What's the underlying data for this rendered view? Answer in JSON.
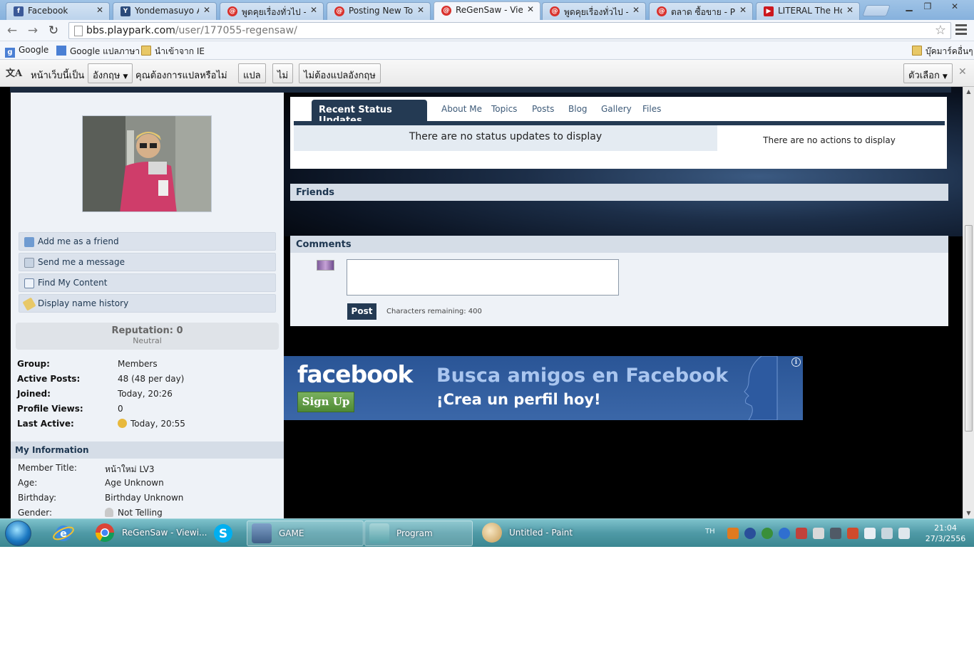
{
  "browser": {
    "tabs": [
      {
        "label": "Facebook",
        "favicon": "facebook-icon",
        "color": "#3b5998",
        "active": false
      },
      {
        "label": "Yondemasuyo Az",
        "favicon": "yondemasuyo-icon",
        "color": "#2b4a7a",
        "active": false
      },
      {
        "label": "พูดคุยเรื่องทั่วไป - P",
        "favicon": "playpark-icon",
        "color": "#d9322d",
        "active": false
      },
      {
        "label": "Posting New Topi",
        "favicon": "playpark-icon",
        "color": "#d9322d",
        "active": false
      },
      {
        "label": "ReGenSaw - Viewi",
        "favicon": "playpark-icon",
        "color": "#d9322d",
        "active": true
      },
      {
        "label": "พูดคุยเรื่องทั่วไป - P",
        "favicon": "playpark-icon",
        "color": "#d9322d",
        "active": false
      },
      {
        "label": "ตลาด ซื้อขาย - Play",
        "favicon": "playpark-icon",
        "color": "#d9322d",
        "active": false
      },
      {
        "label": "LITERAL The Hob",
        "favicon": "youtube-icon",
        "color": "#cc181e",
        "active": false
      }
    ],
    "url_host": "bbs.playpark.com",
    "url_path": "/user/177055-regensaw/",
    "bookmarks": {
      "google": "Google",
      "translate": "Google แปลภาษา",
      "imported_ie": "นำเข้าจาก IE",
      "other": "บุ๊คมาร์คอื่นๆ"
    },
    "translate_bar": {
      "prefix": "หน้าเว็บนี้เป็น",
      "language": "อังกฤษ",
      "question": "คุณต้องการแปลหรือไม่",
      "translate_btn": "แปล",
      "no_btn": "ไม่",
      "never_btn": "ไม่ต้องแปลอังกฤษ",
      "options_btn": "ตัวเลือก"
    }
  },
  "profile": {
    "actions": [
      {
        "label": "Add me as a friend",
        "icon": "add-friend-icon"
      },
      {
        "label": "Send me a message",
        "icon": "message-icon"
      },
      {
        "label": "Find My Content",
        "icon": "content-icon"
      },
      {
        "label": "Display name history",
        "icon": "history-icon"
      }
    ],
    "reputation_label": "Reputation: 0",
    "reputation_status": "Neutral",
    "stats": [
      {
        "key": "Group:",
        "value": "Members"
      },
      {
        "key": "Active Posts:",
        "value": "48 (48 per day)"
      },
      {
        "key": "Joined:",
        "value": "Today, 20:26"
      },
      {
        "key": "Profile Views:",
        "value": "0"
      },
      {
        "key": "Last Active:",
        "value": "Today, 20:55"
      }
    ],
    "my_information_title": "My Information",
    "info": [
      {
        "key": "Member Title:",
        "value": "หน้าใหม่ LV3"
      },
      {
        "key": "Age:",
        "value": "Age Unknown"
      },
      {
        "key": "Birthday:",
        "value": "Birthday Unknown"
      },
      {
        "key": "Gender:",
        "value": "Not Telling"
      }
    ]
  },
  "status": {
    "active_tab": "Recent Status Updates",
    "tabs": [
      "About Me",
      "Topics",
      "Posts",
      "Blog",
      "Gallery",
      "Files"
    ],
    "no_status": "There are no status updates to display",
    "no_actions": "There are no actions to display"
  },
  "friends_title": "Friends",
  "comments": {
    "title": "Comments",
    "post_button": "Post",
    "chars_remaining": "Characters remaining: 400"
  },
  "ad": {
    "logo": "facebook",
    "signup": "Sign Up",
    "headline": "Busca amigos en Facebook",
    "subline": "¡Crea un perfil hoy!",
    "info": "i"
  },
  "taskbar": {
    "items": [
      {
        "label": "ReGenSaw - Viewi...",
        "icon": "chrome-icon"
      },
      {
        "label": "GAME",
        "icon": "game-folder-icon"
      },
      {
        "label": "Program",
        "icon": "program-folder-icon"
      },
      {
        "label": "Untitled - Paint",
        "icon": "paint-icon"
      }
    ],
    "language": "TH",
    "time": "21:04",
    "date": "27/3/2556"
  },
  "colors": {
    "accent_dark": "#243a53",
    "panel_header": "#d5dde7",
    "facebook_blue": "#3b5998"
  }
}
